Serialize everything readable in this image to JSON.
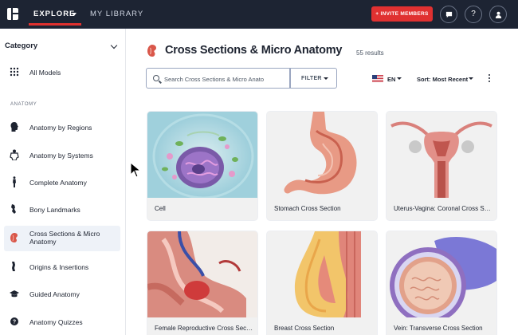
{
  "topbar": {
    "explore_label": "EXPLORE",
    "library_label": "MY LIBRARY",
    "invite_label": "+ INVITE MEMBERS",
    "chat_icon": "chat-icon",
    "help_label": "?",
    "profile_icon": "user-icon",
    "accent_color": "#e03131",
    "bg_color": "#1d2433"
  },
  "sidebar": {
    "category_label": "Category",
    "section_label": "ANATOMY",
    "items": [
      {
        "label": "All Models",
        "icon": "grid-icon"
      },
      {
        "label": "Anatomy by Regions",
        "icon": "head-icon"
      },
      {
        "label": "Anatomy by Systems",
        "icon": "torso-icon"
      },
      {
        "label": "Complete Anatomy",
        "icon": "body-icon"
      },
      {
        "label": "Bony Landmarks",
        "icon": "bone-icon"
      },
      {
        "label": "Cross Sections & Micro Anatomy",
        "icon": "kidney-icon",
        "active": true
      },
      {
        "label": "Origins & Insertions",
        "icon": "muscle-icon"
      },
      {
        "label": "Guided Anatomy",
        "icon": "graduation-cap-icon"
      },
      {
        "label": "Anatomy Quizzes",
        "icon": "quiz-icon"
      }
    ]
  },
  "main": {
    "title": "Cross Sections & Micro Anatomy",
    "results": "55 results",
    "search_placeholder": "Search Cross Sections & Micro Anato",
    "filter_label": "FILTER",
    "language": "EN",
    "sort_label": "Sort: Most Recent",
    "cards": [
      {
        "name": "Cell"
      },
      {
        "name": "Stomach Cross Section"
      },
      {
        "name": "Uterus-Vagina: Coronal Cross Section"
      },
      {
        "name": "Female Reproductive Cross Section"
      },
      {
        "name": "Breast Cross Section"
      },
      {
        "name": "Vein: Transverse Cross Section"
      }
    ]
  }
}
